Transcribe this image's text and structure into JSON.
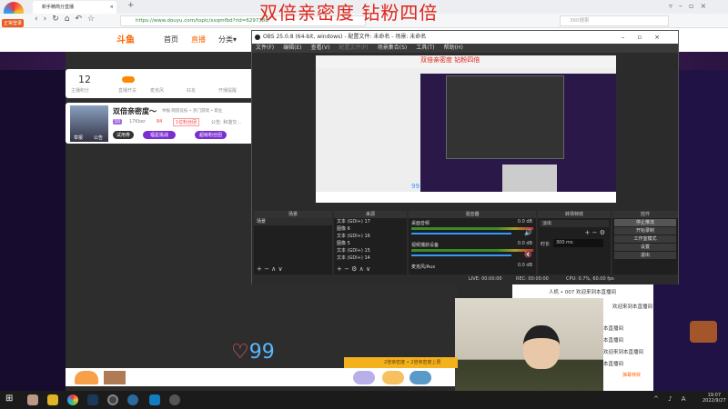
{
  "overlay": {
    "promo_text": "双倍亲密度 钻粉四倍"
  },
  "browser": {
    "badge": "正常登录",
    "tab_title": "新手精简分直播",
    "url": "https://www.douyu.com/topic/xxqmfbd?rid=6297388",
    "search_placeholder": "360搜索"
  },
  "site": {
    "nav": [
      "首页",
      "直播",
      "分类▾"
    ],
    "stats": {
      "count": "12",
      "count_label": "主播积分",
      "items": [
        "直播开关",
        "麦克风",
        "好友",
        "开播提醒"
      ]
    },
    "streamer": {
      "name": "双倍亲密度～",
      "tags": "举报  网游竞技 • 热门游戏 • 职业",
      "level": "55",
      "fans": "17Kber",
      "heat": "84",
      "rank": "1位粉丝团",
      "notice": "公告: 和谐交...",
      "buttons": [
        "试用券",
        "福星挑战",
        "超级粉丝团"
      ],
      "avatar_labels": [
        "举报",
        "公告"
      ]
    },
    "like_count": "99",
    "bottom_notice": "2倍亲密度 • 2倍亲密度上限"
  },
  "obs": {
    "title": "OBS 25.0.8 (64-bit, windows) - 配置文件: 未命名 - 场景: 未命名",
    "menu": [
      "文件(F)",
      "编辑(E)",
      "查看(V)",
      "配置文件(P)",
      "场景集合(S)",
      "工具(T)",
      "帮助(H)"
    ],
    "preview_text": "双倍亲密度 钻粉四倍",
    "preview_likes": "99",
    "docks": {
      "scenes": "场景",
      "sources": "来源",
      "mixer": "混音器",
      "transitions": "转场特效",
      "controls": "控件"
    },
    "scene_items": [
      "场景"
    ],
    "source_items": [
      "文本 (GDI+) 17",
      "图像 6",
      "文本 (GDI+) 16",
      "图像 5",
      "文本 (GDI+) 15",
      "文本 (GDI+) 14"
    ],
    "mixer": [
      {
        "name": "桌面音频",
        "db": "0.0 dB",
        "muted": false
      },
      {
        "name": "视频捕获设备",
        "db": "0.0 dB",
        "muted": true
      },
      {
        "name": "麦克风/Aux",
        "db": "0.0 dB",
        "muted": false
      }
    ],
    "transition": {
      "value": "淡出",
      "duration_label": "时长",
      "duration": "300 ms"
    },
    "controls": [
      "停止推流",
      "开始录制",
      "工作室模式",
      "设置",
      "退出"
    ],
    "status": {
      "live": "LIVE: 00:00:00",
      "rec": "REC: 00:00:00",
      "cpu": "CPU: 0.7%, 60.00 fps"
    }
  },
  "chat": {
    "messages": [
      "人机 • 007 欢迎来到本直播间",
      "欢迎来到本直播间",
      "本直播间",
      "本直播间",
      "欢迎来到本直播间",
      "本直播间"
    ],
    "send_label": "弹幕特效"
  },
  "taskbar": {
    "time": "19:07",
    "date": "2022/9/27"
  }
}
